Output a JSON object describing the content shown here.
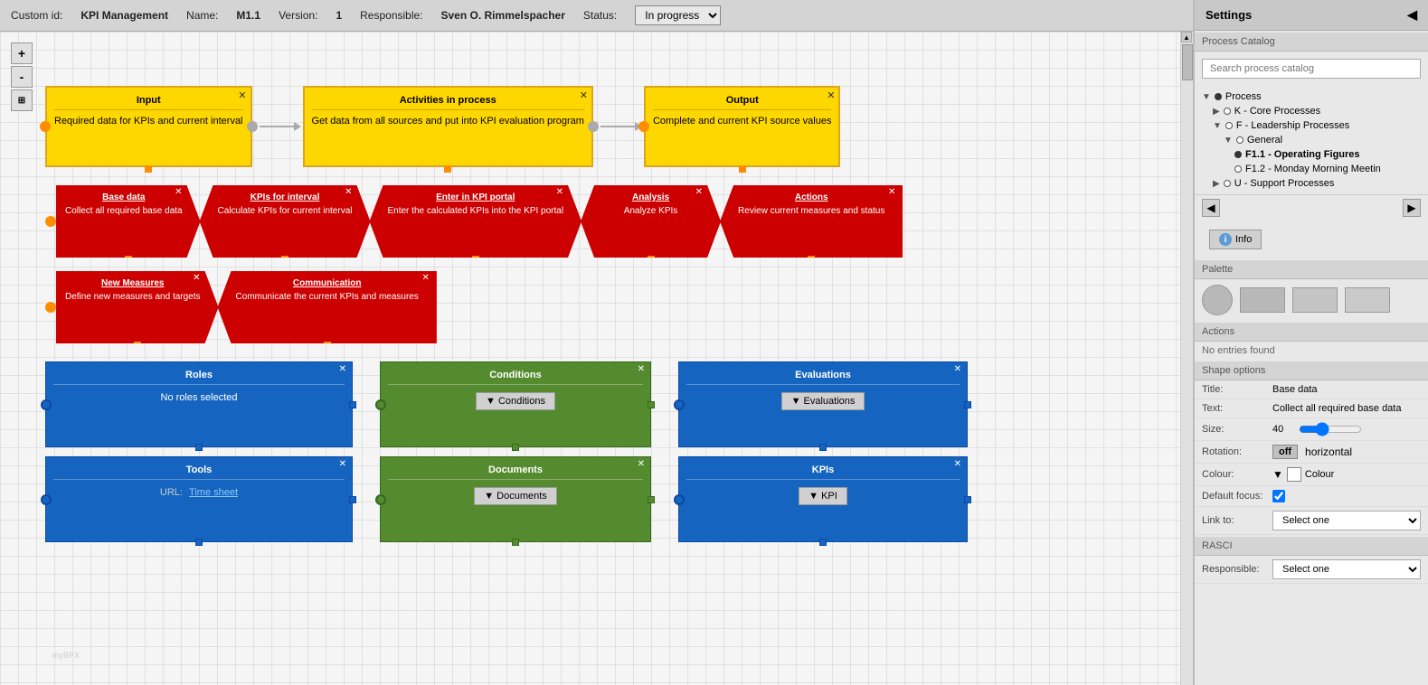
{
  "topbar": {
    "customid_label": "Custom id:",
    "customid_value": "KPI Management",
    "name_label": "Name:",
    "name_value": "M1.1",
    "version_label": "Version:",
    "version_value": "1",
    "responsible_label": "Responsible:",
    "responsible_value": "Sven O. Rimmelspacher",
    "status_label": "Status:",
    "status_value": "In progress"
  },
  "canvas": {
    "zoom_plus": "+",
    "zoom_minus": "-",
    "zoom_fit": "⊞"
  },
  "top_flow": {
    "input": {
      "title": "Input",
      "content": "Required data for KPIs and current interval"
    },
    "activities": {
      "title": "Activities in process",
      "content": "Get data from all sources and put into KPI evaluation program"
    },
    "output": {
      "title": "Output",
      "content": "Complete and current KPI source values"
    }
  },
  "chevron_row1": [
    {
      "title": "Base data",
      "content": "Collect all required base data"
    },
    {
      "title": "KPIs for interval",
      "content": "Calculate KPIs for current interval"
    },
    {
      "title": "Enter in KPI portal",
      "content": "Enter the calculated KPIs into the KPI portal"
    },
    {
      "title": "Analysis",
      "content": "Analyze KPIs"
    },
    {
      "title": "Actions",
      "content": "Review current measures and status"
    }
  ],
  "chevron_row2": [
    {
      "title": "New Measures",
      "content": "Define new measures and targets"
    },
    {
      "title": "Communication",
      "content": "Communicate the current KPIs and measures"
    }
  ],
  "bottom_boxes": {
    "roles": {
      "title": "Roles",
      "content": "No roles selected"
    },
    "conditions": {
      "title": "Conditions",
      "btn": "▼ Conditions"
    },
    "evaluations": {
      "title": "Evaluations",
      "btn": "▼ Evaluations"
    },
    "tools": {
      "title": "Tools",
      "url_label": "URL:",
      "url_link": "Time sheet"
    },
    "documents": {
      "title": "Documents",
      "btn": "▼ Documents"
    },
    "kpis": {
      "title": "KPIs",
      "btn": "▼ KPI"
    }
  },
  "settings": {
    "title": "Settings",
    "collapse": "◀",
    "process_catalog_label": "Process Catalog",
    "search_placeholder": "Search process catalog",
    "tree": {
      "process": "Process",
      "k_core": "K - Core Processes",
      "f_leadership": "F - Leadership Processes",
      "general": "General",
      "f11": "F1.1 - Operating Figures",
      "f12": "F1.2 - Monday Morning Meetin",
      "u_support": "U - Support Processes"
    },
    "info_btn": "Info",
    "palette_label": "Palette",
    "actions_label": "Actions",
    "no_entries": "No entries found",
    "shape_options_label": "Shape options",
    "shape_title_label": "Title:",
    "shape_title_value": "Base data",
    "shape_text_label": "Text:",
    "shape_text_value": "Collect all required base data",
    "shape_size_label": "Size:",
    "shape_size_value": "40",
    "shape_rotation_label": "Rotation:",
    "shape_rotation_off": "off",
    "shape_rotation_horizontal": "horizontal",
    "shape_colour_label": "Colour:",
    "shape_colour_value": "Colour",
    "shape_defaultfocus_label": "Default focus:",
    "shape_linkto_label": "Link to:",
    "shape_linkto_value": "Select one",
    "rasci_label": "RASCI",
    "responsible_label": "Responsible:",
    "responsible_value": "Select one"
  }
}
